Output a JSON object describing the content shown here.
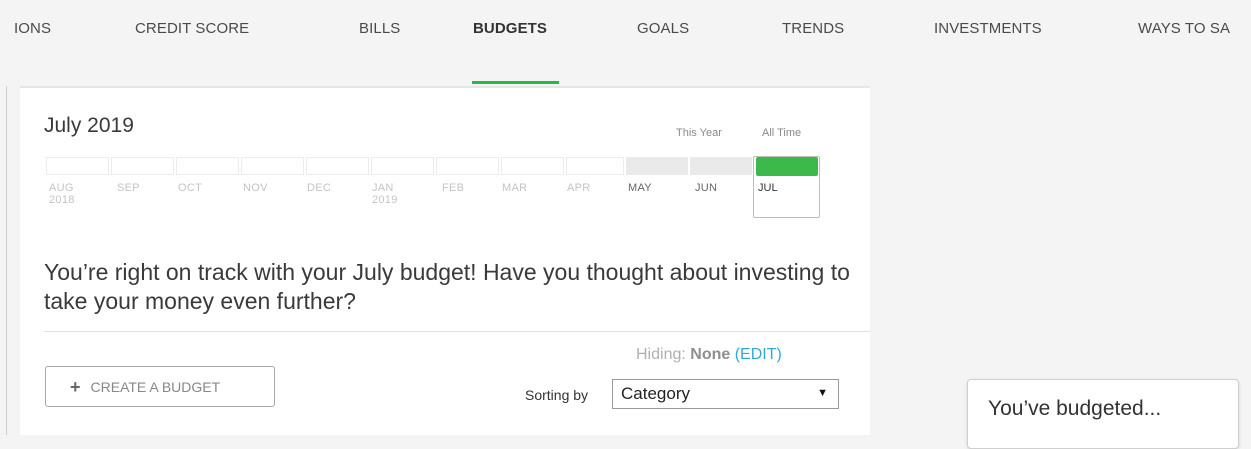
{
  "nav": {
    "tabs": [
      {
        "label": "IONS"
      },
      {
        "label": "CREDIT SCORE"
      },
      {
        "label": "BILLS"
      },
      {
        "label": "BUDGETS"
      },
      {
        "label": "GOALS"
      },
      {
        "label": "TRENDS"
      },
      {
        "label": "INVESTMENTS"
      },
      {
        "label": "WAYS TO SA"
      }
    ],
    "active_tab": "BUDGETS",
    "accent_color": "#22bb4a"
  },
  "period": {
    "title": "July 2019",
    "this_year_label": "This Year",
    "all_time_label": "All Time"
  },
  "timeline": {
    "months": [
      {
        "label": "AUG",
        "year": "2018"
      },
      {
        "label": "SEP",
        "year": ""
      },
      {
        "label": "OCT",
        "year": ""
      },
      {
        "label": "NOV",
        "year": ""
      },
      {
        "label": "DEC",
        "year": ""
      },
      {
        "label": "JAN",
        "year": "2019"
      },
      {
        "label": "FEB",
        "year": ""
      },
      {
        "label": "MAR",
        "year": ""
      },
      {
        "label": "APR",
        "year": ""
      },
      {
        "label": "MAY",
        "year": ""
      },
      {
        "label": "JUN",
        "year": ""
      },
      {
        "label": "JUL",
        "year": ""
      }
    ],
    "selected": "JUL",
    "selected_color": "#3cb94a"
  },
  "message": "You’re right on track with your July budget! Have you thought about investing to take your money even further?",
  "filters": {
    "hiding_label": "Hiding:",
    "hiding_value": "None",
    "edit_label": "(EDIT)"
  },
  "actions": {
    "create_budget_label": "CREATE A BUDGET"
  },
  "sorting": {
    "label": "Sorting by",
    "selected": "Category"
  },
  "popup": {
    "text": "You’ve budgeted..."
  }
}
